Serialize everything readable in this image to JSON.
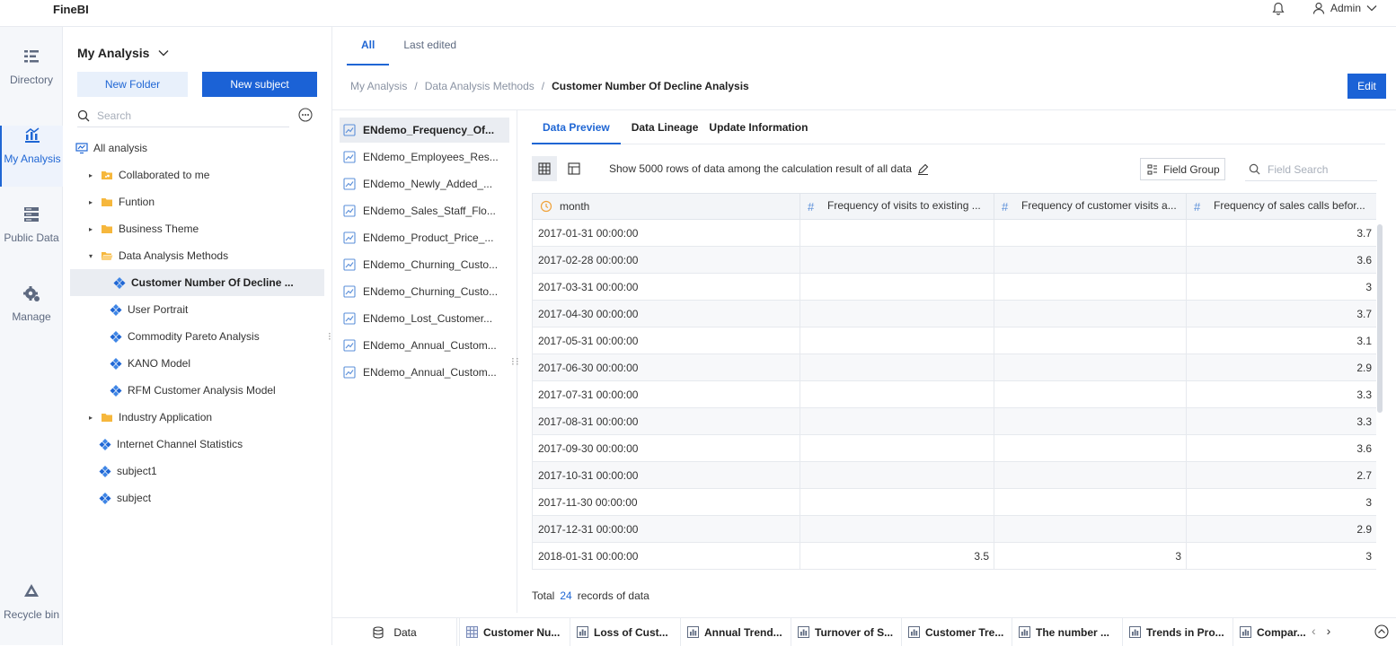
{
  "app": {
    "logo": "FineBI",
    "user": "Admin"
  },
  "nav": [
    {
      "label": "Directory",
      "icon": "directory-icon"
    },
    {
      "label": "My Analysis",
      "icon": "analysis-icon"
    },
    {
      "label": "Public Data",
      "icon": "public-data-icon"
    },
    {
      "label": "Manage",
      "icon": "manage-icon"
    },
    {
      "label": "Recycle bin",
      "icon": "recycle-icon"
    }
  ],
  "tree": {
    "title": "My Analysis",
    "new_folder": "New Folder",
    "new_subject": "New subject",
    "search_placeholder": "Search",
    "items": [
      {
        "label": "All analysis",
        "type": "monitor"
      },
      {
        "label": "Collaborated to me",
        "type": "folder-collab"
      },
      {
        "label": "Funtion",
        "type": "folder"
      },
      {
        "label": "Business Theme",
        "type": "folder"
      },
      {
        "label": "Data Analysis Methods",
        "type": "folder-open"
      },
      {
        "label": "Customer Number Of Decline ...",
        "type": "subject"
      },
      {
        "label": "User Portrait",
        "type": "subject"
      },
      {
        "label": "Commodity Pareto Analysis",
        "type": "subject"
      },
      {
        "label": "KANO Model",
        "type": "subject"
      },
      {
        "label": "RFM Customer Analysis Model",
        "type": "subject"
      },
      {
        "label": "Industry Application",
        "type": "folder"
      },
      {
        "label": "Internet Channel Statistics",
        "type": "subject"
      },
      {
        "label": "subject1",
        "type": "subject"
      },
      {
        "label": "subject",
        "type": "subject"
      }
    ]
  },
  "top_tabs": [
    "All",
    "Last edited"
  ],
  "breadcrumb": [
    "My Analysis",
    "/",
    "Data Analysis Methods",
    "/",
    "Customer Number Of Decline Analysis"
  ],
  "edit_label": "Edit",
  "tables": [
    "ENdemo_Frequency_Of...",
    "ENdemo_Employees_Res...",
    "ENdemo_Newly_Added_...",
    "ENdemo_Sales_Staff_Flo...",
    "ENdemo_Product_Price_...",
    "ENdemo_Churning_Custo...",
    "ENdemo_Churning_Custo...",
    "ENdemo_Lost_Customer...",
    "ENdemo_Annual_Custom...",
    "ENdemo_Annual_Custom..."
  ],
  "preview_tabs": [
    "Data Preview",
    "Data Lineage",
    "Update Information"
  ],
  "toolbar": {
    "info": "Show 5000 rows of data among the calculation result of all data",
    "field_group": "Field Group",
    "field_search_placeholder": "Field Search"
  },
  "grid": {
    "headers": [
      "month",
      "Frequency of visits to existing ...",
      "Frequency of customer visits a...",
      "Frequency of sales calls befor..."
    ],
    "rows": [
      [
        "2017-01-31 00:00:00",
        "",
        "",
        "3.7"
      ],
      [
        "2017-02-28 00:00:00",
        "",
        "",
        "3.6"
      ],
      [
        "2017-03-31 00:00:00",
        "",
        "",
        "3"
      ],
      [
        "2017-04-30 00:00:00",
        "",
        "",
        "3.7"
      ],
      [
        "2017-05-31 00:00:00",
        "",
        "",
        "3.1"
      ],
      [
        "2017-06-30 00:00:00",
        "",
        "",
        "2.9"
      ],
      [
        "2017-07-31 00:00:00",
        "",
        "",
        "3.3"
      ],
      [
        "2017-08-31 00:00:00",
        "",
        "",
        "3.3"
      ],
      [
        "2017-09-30 00:00:00",
        "",
        "",
        "3.6"
      ],
      [
        "2017-10-31 00:00:00",
        "",
        "",
        "2.7"
      ],
      [
        "2017-11-30 00:00:00",
        "",
        "",
        "3"
      ],
      [
        "2017-12-31 00:00:00",
        "",
        "",
        "2.9"
      ],
      [
        "2018-01-31 00:00:00",
        "3.5",
        "3",
        "3"
      ]
    ]
  },
  "total": {
    "prefix": "Total",
    "count": "24",
    "suffix": "records of data"
  },
  "bottom": {
    "data_tab": "Data",
    "tabs": [
      {
        "label": "Customer Nu...",
        "icon": "table-icon"
      },
      {
        "label": "Loss of Cust...",
        "icon": "chart-icon"
      },
      {
        "label": "Annual Trend...",
        "icon": "chart-icon"
      },
      {
        "label": "Turnover of S...",
        "icon": "chart-icon"
      },
      {
        "label": "Customer Tre...",
        "icon": "chart-icon"
      },
      {
        "label": "The number ...",
        "icon": "chart-icon"
      },
      {
        "label": "Trends in Pro...",
        "icon": "chart-icon"
      },
      {
        "label": "Compar...",
        "icon": "chart-icon"
      }
    ]
  },
  "colors": {
    "accent": "#1b62d6",
    "selected_bg": "#eaedf2",
    "nav_bg": "#f5f7fa",
    "folder": "#f6b73c"
  }
}
